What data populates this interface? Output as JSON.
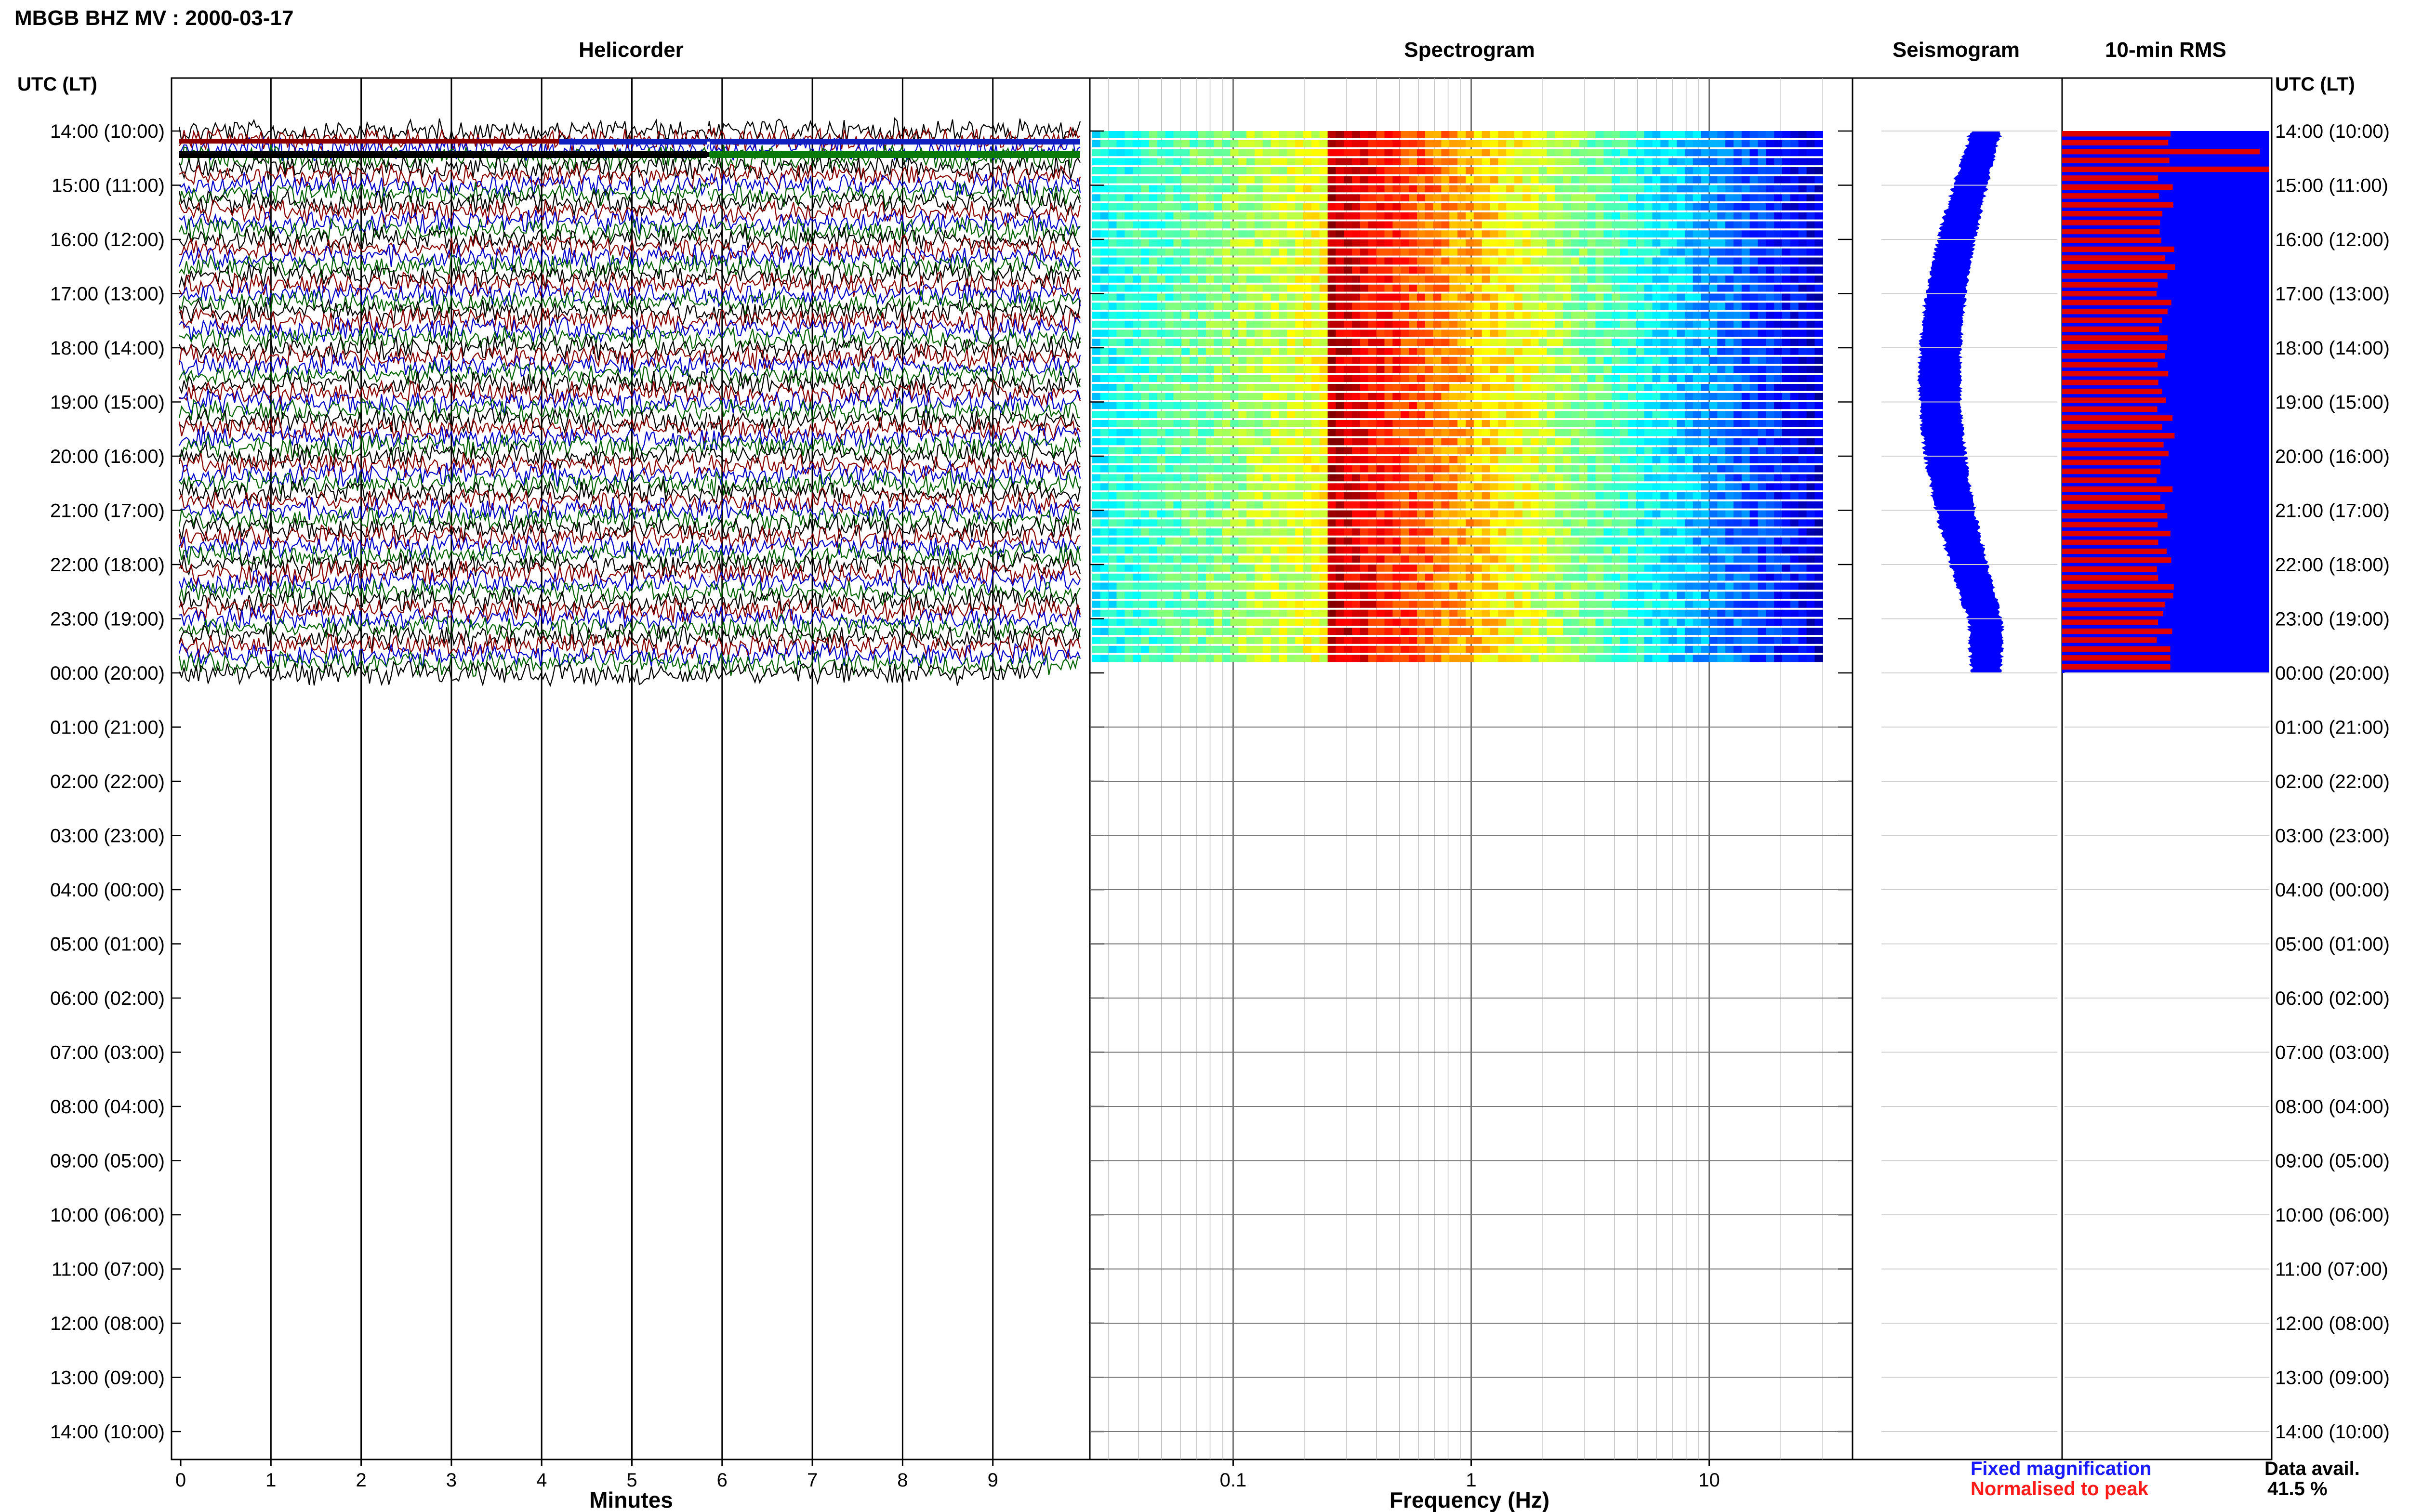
{
  "header": {
    "station_title": "MBGB BHZ MV : 2000-03-17"
  },
  "panels": {
    "helicorder_title": "Helicorder",
    "spectrogram_title": "Spectrogram",
    "seismogram_title": "Seismogram",
    "rms_title": "10-min RMS"
  },
  "axis": {
    "time_header_left": "UTC (LT)",
    "time_header_right": "UTC (LT)",
    "minutes_label": "Minutes",
    "frequency_label": "Frequency (Hz)"
  },
  "legend": {
    "fixed_label": "Fixed magnification",
    "fixed_color": "#1a1aff",
    "normalised_label": "Normalised to peak",
    "normalised_color": "#ff1a1a"
  },
  "availability": {
    "label": "Data avail.",
    "value": "41.5 %"
  },
  "chart_data": {
    "type": "helicorder_panel",
    "time_ticks": [
      "14:00 (10:00)",
      "15:00 (11:00)",
      "16:00 (12:00)",
      "17:00 (13:00)",
      "18:00 (14:00)",
      "19:00 (15:00)",
      "20:00 (16:00)",
      "21:00 (17:00)",
      "22:00 (18:00)",
      "23:00 (19:00)",
      "00:00 (20:00)",
      "01:00 (21:00)",
      "02:00 (22:00)",
      "03:00 (23:00)",
      "04:00 (00:00)",
      "05:00 (01:00)",
      "06:00 (02:00)",
      "07:00 (03:00)",
      "08:00 (04:00)",
      "09:00 (05:00)",
      "10:00 (06:00)",
      "11:00 (07:00)",
      "12:00 (08:00)",
      "13:00 (09:00)",
      "14:00 (10:00)"
    ],
    "minute_ticks": [
      "0",
      "1",
      "2",
      "3",
      "4",
      "5",
      "6",
      "7",
      "8",
      "9"
    ],
    "frequency_ticks": [
      "0.1",
      "1",
      "10"
    ],
    "frequency_range_hz": [
      0.025,
      40
    ],
    "data_hours": 10,
    "trace_colors": [
      "#000000",
      "#8b0000",
      "#0000cd",
      "#006400"
    ],
    "spectrogram_peak_hz": 0.25,
    "rms_fixed_color": "#0000ff",
    "rms_normalised_color": "#e00000"
  }
}
